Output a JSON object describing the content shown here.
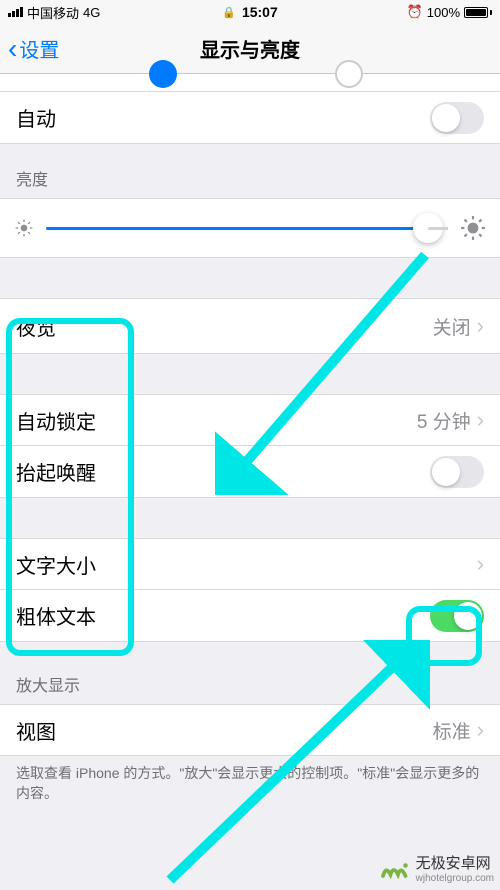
{
  "status": {
    "carrier": "中国移动",
    "network": "4G",
    "time": "15:07",
    "battery_pct": "100%"
  },
  "nav": {
    "back_label": "设置",
    "title": "显示与亮度"
  },
  "rows": {
    "auto": "自动",
    "brightness_header": "亮度",
    "night_shift": "夜览",
    "night_shift_value": "关闭",
    "auto_lock": "自动锁定",
    "auto_lock_value": "5 分钟",
    "raise_to_wake": "抬起唤醒",
    "text_size": "文字大小",
    "bold_text": "粗体文本",
    "zoom_header": "放大显示",
    "view": "视图",
    "view_value": "标准"
  },
  "footer": "选取查看 iPhone 的方式。\"放大\"会显示更大的控制项。\"标准\"会显示更多的内容。",
  "toggles": {
    "auto": false,
    "raise_to_wake": false,
    "bold_text": true
  },
  "slider": {
    "brightness_pct": 95
  },
  "watermark": {
    "title": "无极安卓网",
    "url": "wjhotelgroup.com"
  }
}
